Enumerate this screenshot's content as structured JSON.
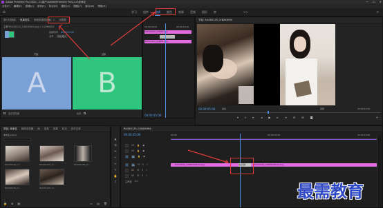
{
  "titlebar": {
    "title": "Adobe Premiere Pro 2020 - C:\\用户\\Adobe\\Premiere Pro\\14.0\\未命名",
    "minimize": "—",
    "maximize": "☐",
    "close": "✕"
  },
  "menu": [
    "文件(F)",
    "编辑(E)",
    "剪辑(C)",
    "序列(S)",
    "标记(M)",
    "图形(G)",
    "视图(V)",
    "窗口(W)",
    "帮助(H)"
  ],
  "workspaces": {
    "tabs": [
      "学习",
      "组件",
      "编辑",
      "颜色",
      "效果",
      "音频",
      "图形",
      "库"
    ],
    "active": "编辑",
    "more": ">>"
  },
  "source_panel": {
    "tabs": [
      "源:(无剪辑)",
      "效果控件",
      "音频剪辑混合器：1",
      "元数据"
    ],
    "active": "效果控件",
    "clip_name": "主要*RUXX0125_CrBXX0HI4.png > 1.29H000X",
    "rows": [
      {
        "label": "过渡",
        "value": "B",
        "alt": "A"
      },
      {
        "label": "持续时间",
        "value": "00:00:01:00"
      },
      {
        "label": "对齐",
        "value": "中心切入"
      }
    ],
    "tile_a_label": "开始",
    "tile_b_label": "结束",
    "tile_a": "A",
    "tile_b": "B",
    "checkbox_label": "显示实际源",
    "reverse_label": "反向"
  },
  "ec_timeline": {
    "tc_left": "00:00:00:00",
    "tc_right": "00:00:10:00",
    "clip1": "RUXX0125_CrBAHI.png",
    "clip2": "RUXX0125_CrBAHI.png"
  },
  "ec_footer_tc": "00:00:05:06",
  "program": {
    "title": "节目: RUXX0125_CrBXX0HI4",
    "timecode": "00:00:05:06",
    "fit": "适合",
    "quality": "完整",
    "duration": "00:00:10:10"
  },
  "project": {
    "tabs": [
      "项目: 未命名",
      "媒体浏览器",
      "库",
      "信息",
      "效果",
      "标记",
      "历史记录"
    ],
    "active": "项目: 未命名",
    "file": "未命名.prproj",
    "items": [
      {
        "name": "RUXX0125_Cr...",
        "dur": "5:00"
      },
      {
        "name": "RUXX0125_Cr...",
        "dur": "5:00"
      },
      {
        "name": "RUXX0125_Cr...",
        "dur": "5:00"
      },
      {
        "name": "RUXX0125_Cr...",
        "dur": "5:00"
      },
      {
        "name": "RUXX0125_Cr...",
        "dur": "5:00"
      }
    ]
  },
  "timeline": {
    "title": "RUXX0125_CrBXX0HI4",
    "timecode": "00:00:05:06",
    "ruler": [
      "00:00",
      "00:00:05:00",
      "00:00:10:00"
    ],
    "video_tracks": [
      "V3",
      "V2",
      "V1"
    ],
    "audio_tracks": [
      "A1",
      "A2",
      "A3"
    ],
    "master": "主声道",
    "master_val": "0.0",
    "clip_left": "RUXX0125_CrBAHI4a4hdd.png",
    "clip_right": "RUXX0125_CrBAHI0a0hdd.png",
    "transition": "交叉溶解"
  },
  "watermark": "最需教育",
  "colors": {
    "accent": "#4f8fe0",
    "clip": "#e16ce1",
    "highlight": "#e03a3a",
    "tile_a": "#7aa0d8",
    "tile_b": "#2fc57e"
  }
}
